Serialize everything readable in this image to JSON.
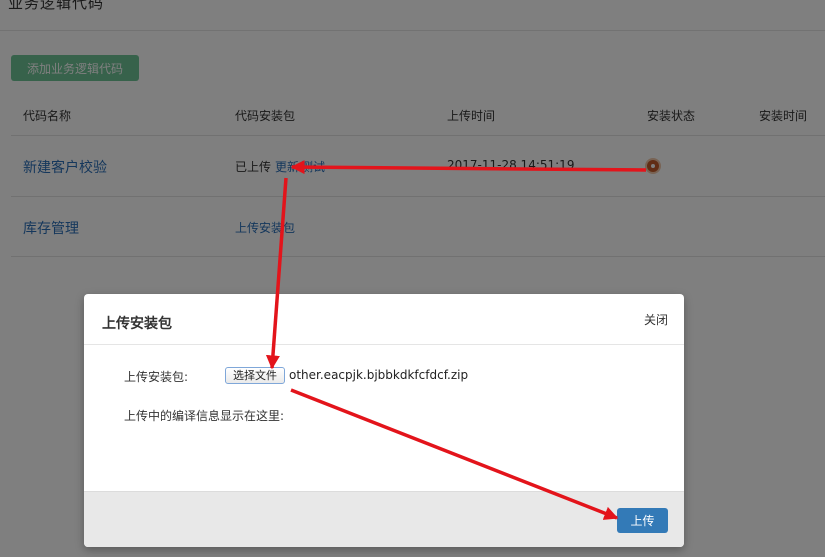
{
  "page": {
    "title": "业务逻辑代码",
    "add_button_label": "添加业务逻辑代码",
    "table": {
      "headers": [
        "代码名称",
        "代码安装包",
        "上传时间",
        "安装状态",
        "安装时间"
      ],
      "rows": [
        {
          "name": "新建客户校验",
          "package_status": "已上传",
          "update_link": "更新",
          "test_link": "测试",
          "upload_time": "2017-11-28 14:51:19"
        },
        {
          "name": "库存管理",
          "upload_link": "上传安装包"
        }
      ]
    }
  },
  "modal": {
    "title": "上传安装包",
    "close_label": "关闭",
    "file_label": "上传安装包:",
    "choose_file_label": "选择文件",
    "file_name": "other.eacpjk.bjbbkdkfcfdcf.zip",
    "info_text": "上传中的编译信息显示在这里:",
    "upload_button_label": "上传"
  },
  "colors": {
    "primary": "#337ab7",
    "success": "#6ec596",
    "link": "#2a6fb8",
    "annotation": "#e3141b"
  }
}
